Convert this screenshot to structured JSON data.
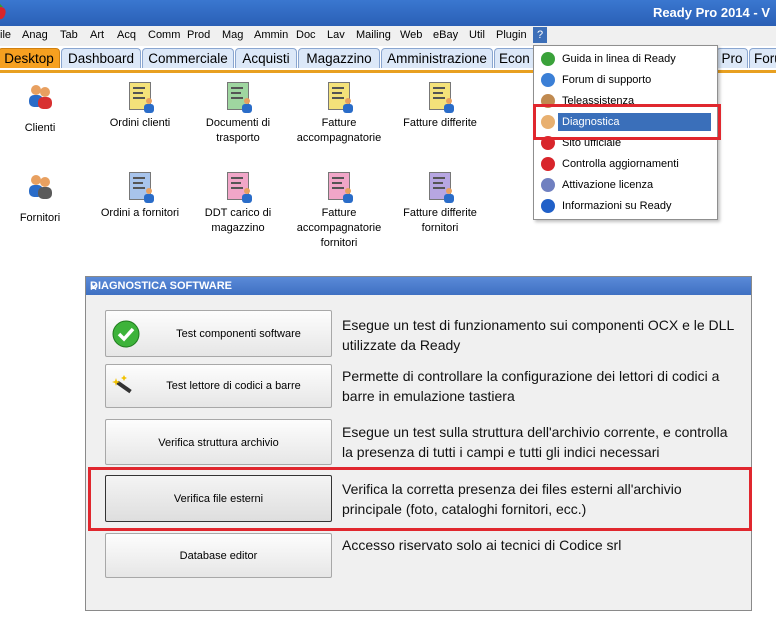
{
  "window": {
    "title": "Ready Pro 2014 - V"
  },
  "menu": [
    "ile",
    "Anag",
    "Tab",
    "Art",
    "Acq",
    "Comm",
    "Prod",
    "Mag",
    "Ammin",
    "Doc",
    "Lav",
    "Mailing",
    "Web",
    "eBay",
    "Util",
    "Plugin",
    "?"
  ],
  "tabs": [
    "Desktop",
    "Dashboard",
    "Commerciale",
    "Acquisti",
    "Magazzino",
    "Amministrazione",
    "Econ",
    "Pro",
    "Foru"
  ],
  "desktop": {
    "row1": [
      "Clienti",
      "Ordini clienti",
      "Documenti di trasporto",
      "Fatture accompagnatorie",
      "Fatture differite"
    ],
    "row2": [
      "Fornitori",
      "Ordini a fornitori",
      "DDT carico di magazzino",
      "Fatture accompagnatorie fornitori",
      "Fatture differite fornitori"
    ]
  },
  "help_menu": {
    "items": [
      {
        "label": "Guida in linea di Ready",
        "icon": "help-green-icon"
      },
      {
        "label": "Forum di supporto",
        "icon": "forum-globe-icon"
      },
      {
        "label": "Teleassistenza",
        "icon": "user-support-icon"
      },
      {
        "label": "Diagnostica",
        "icon": "diagnostic-user-icon"
      },
      {
        "label": "Sito ufficiale",
        "icon": "strawberry-icon"
      },
      {
        "label": "Controlla aggiornamenti",
        "icon": "strawberry-update-icon"
      },
      {
        "label": "Attivazione licenza",
        "icon": "license-people-icon"
      },
      {
        "label": "Informazioni su Ready",
        "icon": "info-icon"
      }
    ],
    "selected": "Diagnostica"
  },
  "dialog": {
    "title": "DIAGNOSTICA SOFTWARE",
    "close": "×",
    "rows": [
      {
        "button": "Test componenti software",
        "description": "Esegue un test di funzionamento sui componenti OCX e le DLL utilizzate da Ready"
      },
      {
        "button": "Test lettore di codici a barre",
        "description": "Permette di controllare la configurazione dei lettori di codici a barre in emulazione tastiera"
      },
      {
        "button": "Verifica struttura archivio",
        "description": "Esegue un test sulla struttura dell'archivio corrente, e controlla la presenza di tutti i campi e tutti gli indici necessari"
      },
      {
        "button": "Verifica file esterni",
        "description": "Verifica la corretta presenza dei files esterni all'archivio principale (foto, cataloghi fornitori, ecc.)"
      },
      {
        "button": "Database editor",
        "description": "Accesso riservato solo ai tecnici di Codice srl"
      }
    ]
  },
  "colors": {
    "accent_tab": "#f6a020",
    "highlight": "#e0272e",
    "selection": "#3a6fba"
  }
}
